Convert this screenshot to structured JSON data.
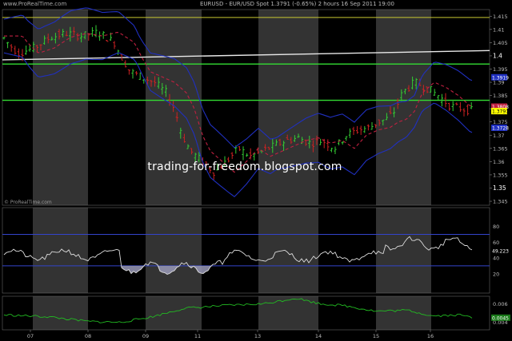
{
  "header": {
    "brand": "www.ProRealTime.com",
    "title": "EURUSD - EUR/USD Spot    1.3791 (-0.65%)    2 hours  16 Sep 2011 19:00"
  },
  "price_panel": {
    "copyright": "© ProRealTime.com",
    "yaxis_labels": [
      "1.415",
      "1.41",
      "1.405",
      "1.4",
      "1.395",
      "1.39",
      "1.385",
      "1.38",
      "1.375",
      "1.37",
      "1.365",
      "1.36",
      "1.355",
      "1.35",
      "1.345"
    ],
    "price_tags": {
      "upper_band": "1.3919",
      "red_ma": "1.3808",
      "last": "1.3791",
      "lower_band": "1.3728"
    },
    "levels": {
      "yellow": [
        1.4145,
        1.3832
      ],
      "green": [
        1.3969,
        1.3832
      ],
      "white_trend": [
        [
          0,
          1.3985
        ],
        [
          600,
          1.4018
        ]
      ]
    }
  },
  "rsi_panel": {
    "yaxis_labels": [
      "80",
      "60",
      "40",
      "20"
    ],
    "current": "49.223",
    "levels": [
      70,
      30
    ]
  },
  "osc_panel": {
    "yaxis_labels": [
      "0.006",
      "0.004"
    ],
    "current": "0.0045"
  },
  "xaxis": {
    "labels": [
      "07",
      "08",
      "09",
      "11",
      "13",
      "14",
      "15",
      "16"
    ]
  },
  "watermark": "trading-for-freedom.blogspot.com",
  "colors": {
    "background": "#000000",
    "session_shade": "#333333",
    "yellow_level": "#c8c832",
    "green_level": "#33dd33",
    "band": "#2030c0",
    "ma": "#c02040",
    "up_candle": "#33cc33",
    "down_candle": "#cc2222",
    "rsi": "#dddddd",
    "osc": "#22bb22"
  },
  "icons": {
    "brand": "prorealtime-logo"
  }
}
